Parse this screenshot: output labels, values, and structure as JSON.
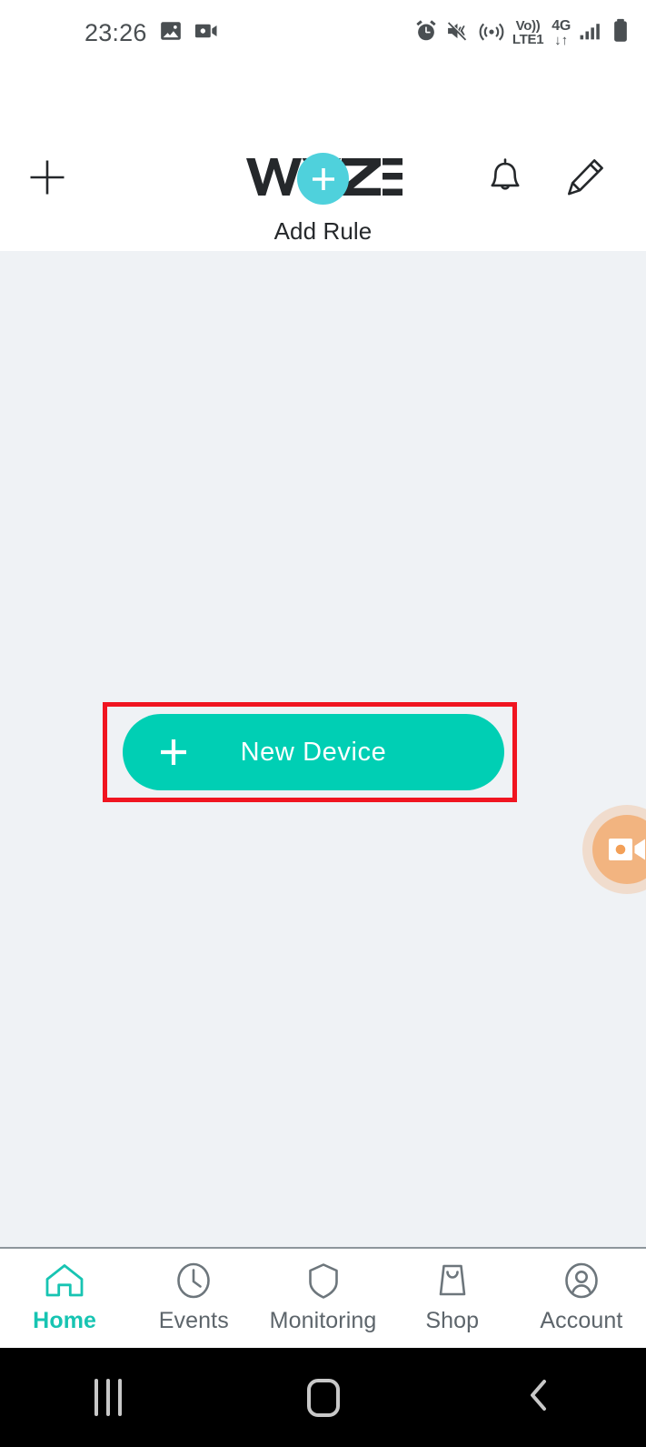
{
  "status_bar": {
    "time": "23:26",
    "left_icons": [
      "photo-icon",
      "video-camera-icon"
    ],
    "right_icons": [
      "alarm-clock-icon",
      "mute-vibrate-icon",
      "hotspot-icon"
    ],
    "volte": {
      "line1": "Vo))",
      "line2": "LTE1"
    },
    "network": {
      "line1": "4G",
      "line2": "↓↑"
    },
    "signal_icon": "signal-bars-icon",
    "battery_icon": "battery-icon"
  },
  "header": {
    "add_icon": "plus-icon",
    "logo_text": "WYZ",
    "logo_full": "WYZE",
    "notification_icon": "bell-icon",
    "edit_icon": "pencil-icon"
  },
  "add_rule": {
    "icon": "plus-icon",
    "label": "Add Rule",
    "circle_color": "#4FD1DC"
  },
  "main": {
    "background_color": "#eff2f5",
    "new_device_button": {
      "icon": "plus-icon",
      "label": "New Device",
      "color": "#00cfb4"
    },
    "highlight": {
      "color": "#f01520",
      "target": "new-device-button"
    },
    "floating_recorder": {
      "icon": "video-camera-icon",
      "color": "#f3a058"
    }
  },
  "tabs": [
    {
      "label": "Home",
      "icon": "house-icon",
      "active": true
    },
    {
      "label": "Events",
      "icon": "clock-icon",
      "active": false
    },
    {
      "label": "Monitoring",
      "icon": "shield-icon",
      "active": false
    },
    {
      "label": "Shop",
      "icon": "shopping-bag-icon",
      "active": false
    },
    {
      "label": "Account",
      "icon": "user-circle-icon",
      "active": false
    }
  ],
  "tab_colors": {
    "active": "#17c4b2",
    "inactive": "#5d656b"
  },
  "system_nav": {
    "recents": "recent-apps-icon",
    "home": "home-square-icon",
    "back": "back-chevron-icon"
  }
}
